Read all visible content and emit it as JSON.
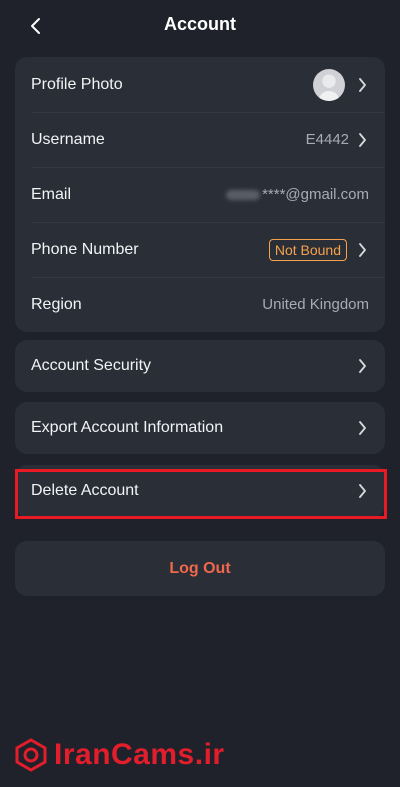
{
  "header": {
    "title": "Account"
  },
  "profile": {
    "rows": [
      {
        "label": "Profile Photo"
      },
      {
        "label": "Username",
        "value": "E4442"
      },
      {
        "label": "Email",
        "value": "****@gmail.com"
      },
      {
        "label": "Phone Number",
        "value": "Not Bound"
      },
      {
        "label": "Region",
        "value": "United Kingdom"
      }
    ]
  },
  "menu": {
    "account_security": "Account Security",
    "export_info": "Export Account Information",
    "delete_account": "Delete Account"
  },
  "logout": {
    "label": "Log Out"
  },
  "watermark": {
    "text": "IranCams.ir"
  },
  "colors": {
    "background": "#1f222a",
    "card": "#2a2e37",
    "badge": "#f5a24b",
    "logout": "#f0674c",
    "highlight": "#e81a23"
  }
}
